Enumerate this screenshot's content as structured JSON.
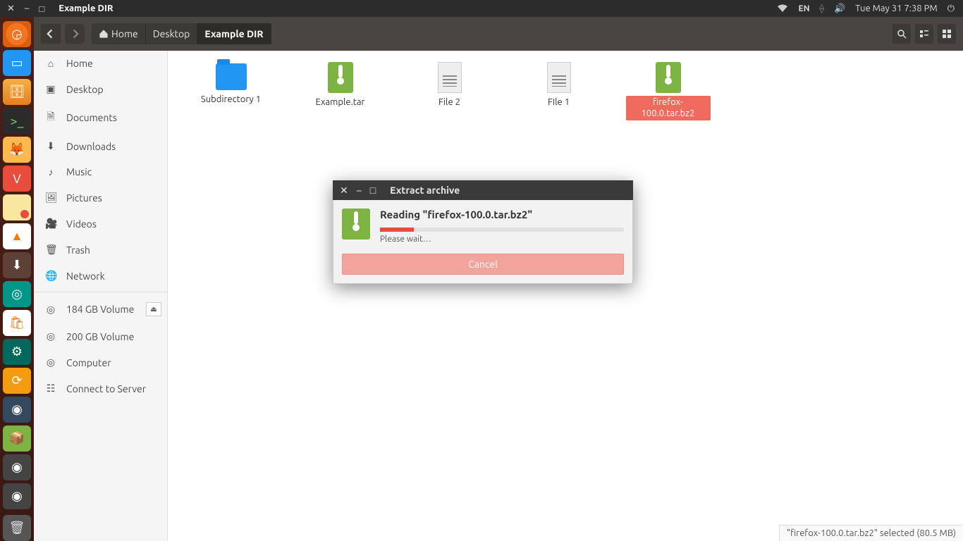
{
  "window": {
    "title": "Example DIR"
  },
  "system": {
    "lang": "EN",
    "datetime": "Tue May 31  7:38 PM"
  },
  "breadcrumbs": [
    {
      "label": "Home",
      "icon": "home"
    },
    {
      "label": "Desktop"
    },
    {
      "label": "Example DIR",
      "active": true
    }
  ],
  "sidebar": {
    "places": [
      {
        "label": "Home",
        "icon": "⌂"
      },
      {
        "label": "Desktop",
        "icon": "▣"
      },
      {
        "label": "Documents",
        "icon": "🗎"
      },
      {
        "label": "Downloads",
        "icon": "⬇"
      },
      {
        "label": "Music",
        "icon": "♪"
      },
      {
        "label": "Pictures",
        "icon": "🖼"
      },
      {
        "label": "Videos",
        "icon": "🎥"
      },
      {
        "label": "Trash",
        "icon": "🗑"
      },
      {
        "label": "Network",
        "icon": "🌐"
      }
    ],
    "devices": [
      {
        "label": "184 GB Volume",
        "eject": true
      },
      {
        "label": "200 GB Volume"
      },
      {
        "label": "Computer"
      },
      {
        "label": "Connect to Server"
      }
    ]
  },
  "files": [
    {
      "name": "Subdirectory 1",
      "type": "folder"
    },
    {
      "name": "Example.tar",
      "type": "archive"
    },
    {
      "name": "File 2",
      "type": "text"
    },
    {
      "name": "FIle 1",
      "type": "text"
    },
    {
      "name": "firefox-100.0.tar.bz2",
      "type": "archive",
      "selected": true
    }
  ],
  "status": {
    "text": "\"firefox-100.0.tar.bz2\" selected  (80.5 MB)"
  },
  "dialog": {
    "title": "Extract archive",
    "heading": "Reading \"firefox-100.0.tar.bz2\"",
    "wait": "Please wait…",
    "cancel": "Cancel"
  }
}
